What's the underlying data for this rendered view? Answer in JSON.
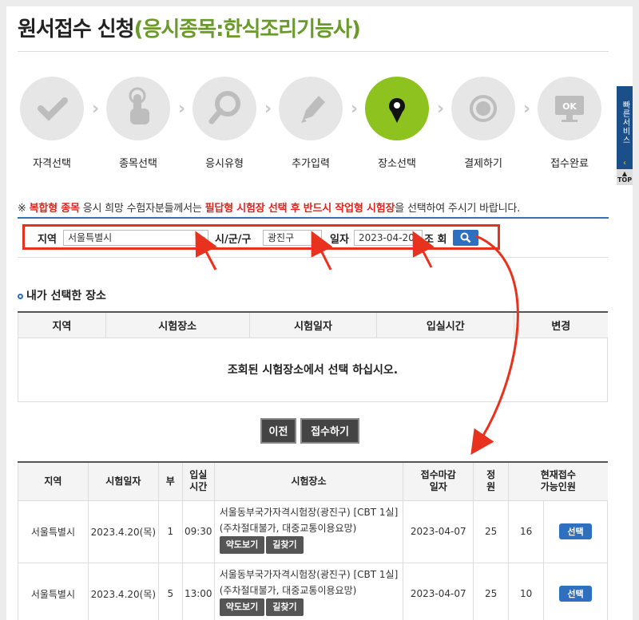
{
  "title": {
    "main": "원서접수 신청",
    "sub": "(응시종목:한식조리기능사)"
  },
  "steps": [
    {
      "label": "자격선택",
      "icon": "check-icon",
      "active": false
    },
    {
      "label": "종목선택",
      "icon": "touch-icon",
      "active": false
    },
    {
      "label": "응시유형",
      "icon": "magnifier-icon",
      "active": false
    },
    {
      "label": "추가입력",
      "icon": "pencil-icon",
      "active": false
    },
    {
      "label": "장소선택",
      "icon": "location-pin-icon",
      "active": true
    },
    {
      "label": "결제하기",
      "icon": "won-coin-icon",
      "active": false
    },
    {
      "label": "접수완료",
      "icon": "ok-monitor-icon",
      "active": false
    }
  ],
  "side": {
    "service_label": "빠른서비스",
    "top_label": "TOP"
  },
  "notice": {
    "prefix": "※ ",
    "red1": "복합형 종목",
    "mid": " 응시 희망 수험자분들께서는 ",
    "red2": "필답형 시험장 선택 후 반드시 작업형 시험장",
    "suffix": "을 선택하여 주시기 바랍니다."
  },
  "search": {
    "region_label": "지역",
    "region_value": "서울특별시",
    "city_label": "시/군/구",
    "city_value": "광진구",
    "date_label": "일자",
    "date_value": "2023-04-20",
    "query_label": "조 회"
  },
  "selected": {
    "heading": "내가 선택한 장소",
    "columns": [
      "지역",
      "시험장소",
      "시험일자",
      "입실시간",
      "변경"
    ],
    "empty_message": "조회된 시험장소에서 선택 하십시오."
  },
  "buttons": {
    "prev": "이전",
    "submit": "접수하기"
  },
  "results": {
    "columns": [
      "지역",
      "시험일자",
      "부",
      "입실\n시간",
      "시험장소",
      "접수마감\n일자",
      "정\n원",
      "현재접수\n가능인원"
    ],
    "rows": [
      {
        "region": "서울특별시",
        "date": "2023.4.20(목)",
        "part": "1",
        "time": "09:30",
        "place": "서울동부국가자격시험장(광진구) [CBT 1실](주차절대불가, 대중교통이용요망)",
        "deadline": "2023-04-07",
        "capacity": "25",
        "available": "16",
        "map": "약도보기",
        "route": "길찾기",
        "select": "선택"
      },
      {
        "region": "서울특별시",
        "date": "2023.4.20(목)",
        "part": "5",
        "time": "13:00",
        "place": "서울동부국가자격시험장(광진구) [CBT 1실](주차절대불가, 대중교통이용요망)",
        "deadline": "2023-04-07",
        "capacity": "25",
        "available": "10",
        "map": "약도보기",
        "route": "길찾기",
        "select": "선택"
      }
    ]
  },
  "colors": {
    "accent_green": "#8dc21f",
    "title_green": "#6a9a2a",
    "highlight_red": "#e8321e",
    "button_blue": "#2e6fbf"
  }
}
